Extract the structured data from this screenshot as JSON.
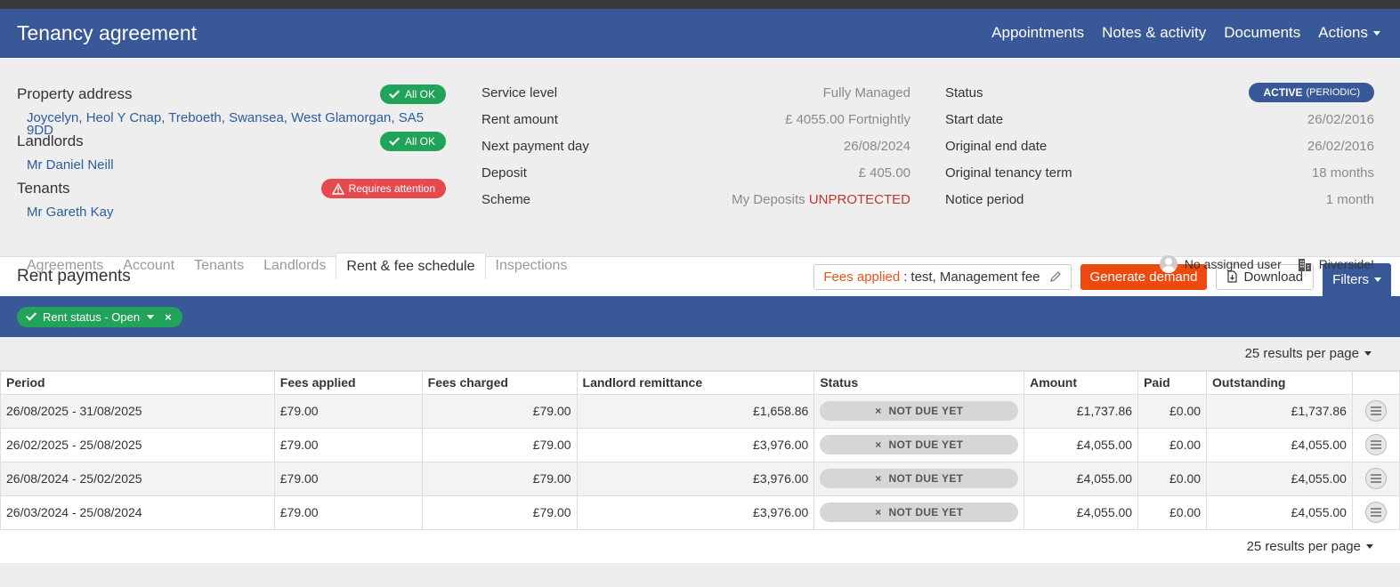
{
  "header": {
    "title": "Tenancy agreement",
    "nav": [
      "Appointments",
      "Notes & activity",
      "Documents",
      "Actions"
    ]
  },
  "property": {
    "label": "Property address",
    "badge": "All OK",
    "address": "Joycelyn, Heol Y Cnap, Treboeth, Swansea, West Glamorgan, SA5 9DD"
  },
  "landlords": {
    "label": "Landlords",
    "badge": "All OK",
    "name": "Mr Daniel Neill"
  },
  "tenants": {
    "label": "Tenants",
    "badge": "Requires attention",
    "name": "Mr Gareth Kay"
  },
  "details": {
    "service_level_label": "Service level",
    "service_level": "Fully Managed",
    "rent_amount_label": "Rent amount",
    "rent_amount": "£ 4055.00 Fortnightly",
    "next_payment_label": "Next payment day",
    "next_payment": "26/08/2024",
    "deposit_label": "Deposit",
    "deposit": "£ 405.00",
    "scheme_label": "Scheme",
    "scheme": "My Deposits",
    "scheme_status": "UNPROTECTED"
  },
  "tenancy": {
    "status_label": "Status",
    "status": "ACTIVE",
    "status_sub": "(PERIODIC)",
    "start_label": "Start date",
    "start": "26/02/2016",
    "end_label": "Original end date",
    "end": "26/02/2016",
    "term_label": "Original tenancy term",
    "term": "18 months",
    "notice_label": "Notice period",
    "notice": "1 month"
  },
  "tabs": [
    "Agreements",
    "Account",
    "Tenants",
    "Landlords",
    "Rent & fee schedule",
    "Inspections"
  ],
  "assignment": {
    "user": "No assigned user",
    "branch": "Riverside!"
  },
  "rent": {
    "title": "Rent payments",
    "fees_label": "Fees applied",
    "fees_value": "test, Management fee",
    "generate_label": "Generate demand",
    "download_label": "Download",
    "filters_label": "Filters"
  },
  "filter": {
    "chip": "Rent status - Open"
  },
  "pagination": {
    "per_page": "25 results per page"
  },
  "table": {
    "columns": [
      "Period",
      "Fees applied",
      "Fees charged",
      "Landlord remittance",
      "Status",
      "Amount",
      "Paid",
      "Outstanding"
    ],
    "rows": [
      {
        "period": "26/08/2025 - 31/08/2025",
        "fees_applied": "£79.00",
        "fees_charged": "£79.00",
        "remittance": "£1,658.86",
        "status": "NOT DUE YET",
        "amount": "£1,737.86",
        "paid": "£0.00",
        "outstanding": "£1,737.86"
      },
      {
        "period": "26/02/2025 - 25/08/2025",
        "fees_applied": "£79.00",
        "fees_charged": "£79.00",
        "remittance": "£3,976.00",
        "status": "NOT DUE YET",
        "amount": "£4,055.00",
        "paid": "£0.00",
        "outstanding": "£4,055.00"
      },
      {
        "period": "26/08/2024 - 25/02/2025",
        "fees_applied": "£79.00",
        "fees_charged": "£79.00",
        "remittance": "£3,976.00",
        "status": "NOT DUE YET",
        "amount": "£4,055.00",
        "paid": "£0.00",
        "outstanding": "£4,055.00"
      },
      {
        "period": "26/03/2024 - 25/08/2024",
        "fees_applied": "£79.00",
        "fees_charged": "£79.00",
        "remittance": "£3,976.00",
        "status": "NOT DUE YET",
        "amount": "£4,055.00",
        "paid": "£0.00",
        "outstanding": "£4,055.00"
      }
    ]
  },
  "colors": {
    "brand": "#385898",
    "ok": "#21a35a",
    "warn": "#e64a4f",
    "accent": "#ec4a0e"
  }
}
